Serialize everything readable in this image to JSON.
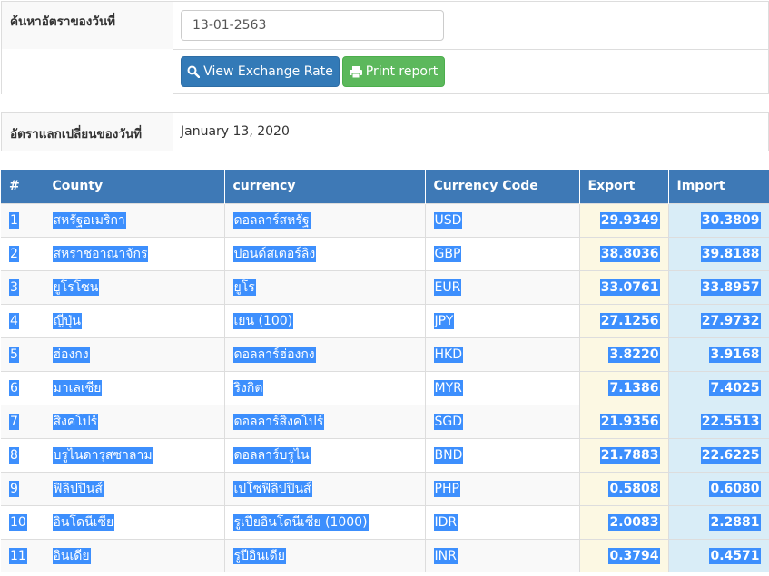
{
  "search": {
    "label": "ค้นหาอัตราของวันที่",
    "date_value": "13-01-2563",
    "view_button": "View Exchange Rate",
    "print_button": "Print report"
  },
  "rate_date": {
    "label": "อัตราแลกเปลี่ยนของวันที่",
    "value": "January 13, 2020"
  },
  "table": {
    "headers": [
      "#",
      "County",
      "currency",
      "Currency Code",
      "Export",
      "Import"
    ],
    "rows": [
      {
        "no": "1",
        "country": "สหรัฐอเมริกา",
        "currency": "ดอลลาร์สหรัฐ",
        "code": "USD",
        "export": "29.9349",
        "import": "30.3809"
      },
      {
        "no": "2",
        "country": "สหราชอาณาจักร",
        "currency": "ปอนด์สเตอร์ลิง",
        "code": "GBP",
        "export": "38.8036",
        "import": "39.8188"
      },
      {
        "no": "3",
        "country": "ยูโรโซน",
        "currency": "ยูโร",
        "code": "EUR",
        "export": "33.0761",
        "import": "33.8957"
      },
      {
        "no": "4",
        "country": "ญี่ปุ่น",
        "currency": "เยน (100)",
        "code": "JPY",
        "export": "27.1256",
        "import": "27.9732"
      },
      {
        "no": "5",
        "country": "ฮ่องกง",
        "currency": "ดอลลาร์ฮ่องกง",
        "code": "HKD",
        "export": "3.8220",
        "import": "3.9168"
      },
      {
        "no": "6",
        "country": "มาเลเซีย",
        "currency": "ริงกิต",
        "code": "MYR",
        "export": "7.1386",
        "import": "7.4025"
      },
      {
        "no": "7",
        "country": "สิงคโปร์",
        "currency": "ดอลลาร์สิงคโปร์",
        "code": "SGD",
        "export": "21.9356",
        "import": "22.5513"
      },
      {
        "no": "8",
        "country": "บรูไนดารุสซาลาม",
        "currency": "ดอลลาร์บรูไน",
        "code": "BND",
        "export": "21.7883",
        "import": "22.6225"
      },
      {
        "no": "9",
        "country": "ฟิลิปปินส์",
        "currency": "เปโซฟิลิปปินส์",
        "code": "PHP",
        "export": "0.5808",
        "import": "0.6080"
      },
      {
        "no": "10",
        "country": "อินโดนีเซีย",
        "currency": "รูเปียอินโดนีเซีย (1000)",
        "code": "IDR",
        "export": "2.0083",
        "import": "2.2881"
      },
      {
        "no": "11",
        "country": "อินเดีย",
        "currency": "รูปีอินเดีย",
        "code": "INR",
        "export": "0.3794",
        "import": "0.4571"
      }
    ]
  },
  "colors": {
    "header_bg": "#3e79b6",
    "view_button": "#337ab7",
    "print_button": "#5cb85c",
    "export_col": "#fcf8e3",
    "import_col": "#d9edf7",
    "selection": "#3d8ffd"
  },
  "icons": {
    "view": "search-icon",
    "print": "printer-icon"
  }
}
